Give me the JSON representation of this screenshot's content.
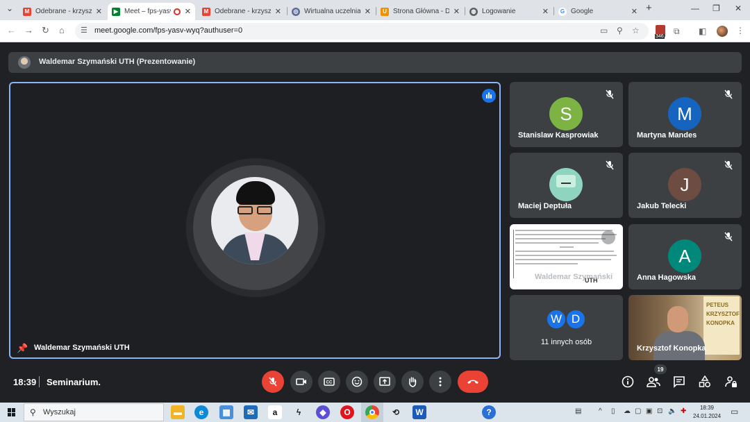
{
  "browser": {
    "tabs": [
      {
        "title": "Odebrane - krzysztof",
        "favicon": "gmail-icon"
      },
      {
        "title": "Meet – fps-yasv",
        "favicon": "meet-icon",
        "active": true
      },
      {
        "title": "Odebrane - krzysztof",
        "favicon": "gmail-icon"
      },
      {
        "title": "Wirtualna uczelnia |",
        "favicon": "university-icon"
      },
      {
        "title": "Strona Główna - Do",
        "favicon": "u-icon"
      },
      {
        "title": "Logowanie",
        "favicon": "globe-icon"
      },
      {
        "title": "Google",
        "favicon": "google-icon"
      }
    ],
    "url": "meet.google.com/fps-yasv-wyq?authuser=0",
    "extension_badge": "346"
  },
  "meet": {
    "presenting_banner": "Waldemar Szymański UTH (Prezentowanie)",
    "main_tile_name": "Waldemar Szymański UTH",
    "participants": [
      {
        "name": "Stanislaw Kasprowiak",
        "initial": "S",
        "color": "#7cb342"
      },
      {
        "name": "Martyna Mandes",
        "initial": "M",
        "color": "#1565c0"
      },
      {
        "name": "Maciej Deptuła",
        "initial": "",
        "color": "#8fd4be"
      },
      {
        "name": "Jakub Telecki",
        "initial": "J",
        "color": "#6d4c41"
      },
      {
        "name": "Waldemar Szymański",
        "initial": "",
        "color": "#ffffff"
      },
      {
        "name": "Anna Hagowska",
        "initial": "A",
        "color": "#00897b"
      },
      {
        "name": "11 innych osób",
        "initial": "",
        "color": "#3c4043"
      },
      {
        "name": "Krzysztof Konopka",
        "initial": "",
        "color": "#8a7050"
      }
    ],
    "others_initials": [
      "W",
      "D"
    ],
    "doc_logo": "UTH",
    "poster_text": "PETEUS KRZYSZTOF KONOPKA",
    "time": "18:39",
    "meeting_name": "Seminarium.",
    "participants_count": "19"
  },
  "taskbar": {
    "search_placeholder": "Wyszukaj",
    "clock_time": "18:39",
    "clock_date": "24.01.2024"
  }
}
